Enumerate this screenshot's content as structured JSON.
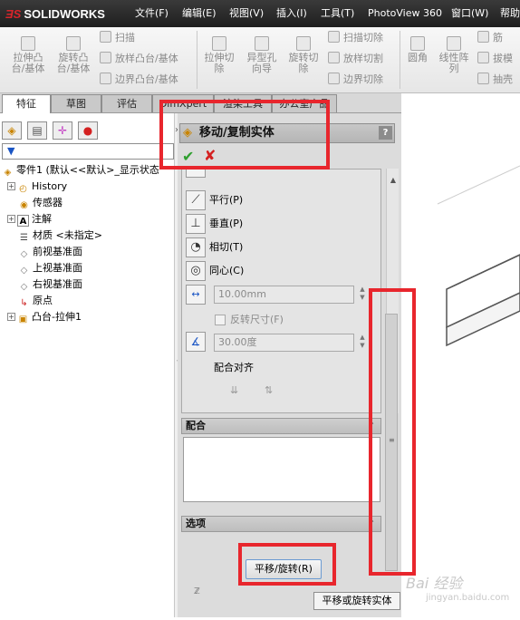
{
  "app": {
    "name": "SOLIDWORKS"
  },
  "menu": [
    "文件(F)",
    "编辑(E)",
    "视图(V)",
    "插入(I)",
    "工具(T)",
    "PhotoView 360",
    "窗口(W)",
    "帮助"
  ],
  "ribbon": {
    "extrude_boss": "拉伸凸\n台/基体",
    "revolve_boss": "旋转凸\n台/基体",
    "sweep": "扫描",
    "loft_boss": "放样凸台/基体",
    "boundary_boss": "边界凸台/基体",
    "extrude_cut": "拉伸切\n除",
    "hole_wizard": "异型孔\n向导",
    "revolve_cut": "旋转切\n除",
    "swept_cut": "扫描切除",
    "lofted_cut": "放样切割",
    "boundary_cut": "边界切除",
    "fillet": "圆角",
    "linear_pattern": "线性阵\n列",
    "rib": "筋",
    "draft": "拔模",
    "shell": "抽壳"
  },
  "tabs": [
    "特征",
    "草图",
    "评估",
    "DimXpert",
    "渲染工具",
    "办公室产品"
  ],
  "tree": {
    "root": "零件1 (默认<<默认>_显示状态",
    "items": [
      "History",
      "传感器",
      "注解",
      "材质 <未指定>",
      "前视基准面",
      "上视基准面",
      "右视基准面",
      "原点",
      "凸台-拉伸1"
    ]
  },
  "property_manager": {
    "title": "移动/复制实体",
    "help": "?",
    "mates": {
      "parallel": "平行(P)",
      "perpendicular": "垂直(P)",
      "tangent": "相切(T)",
      "concentric": "同心(C)",
      "distance_value": "10.00mm",
      "flip_dimension": "反转尺寸(F)",
      "angle_value": "30.00度",
      "mate_alignment": "配合对齐"
    },
    "mates_group": "配合",
    "options_group": "选项",
    "translate_rotate_button": "平移/旋转(R)",
    "tooltip": "平移或旋转实体"
  },
  "watermark": {
    "text": "Bai 经验",
    "sub": "jingyan.baidu.com"
  },
  "colors": {
    "highlight": "#e8262d",
    "titlebar": "#2b2b2b",
    "ok": "#2f9f2f",
    "cancel": "#d42020"
  }
}
